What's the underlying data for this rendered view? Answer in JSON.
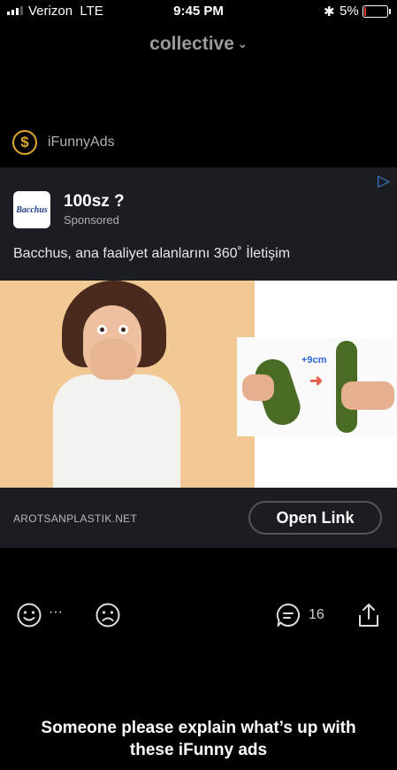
{
  "status_bar": {
    "carrier": "Verizon",
    "network": "LTE",
    "time": "9:45 PM",
    "battery_percent": "5%"
  },
  "header": {
    "title": "collective"
  },
  "ad_source": {
    "name": "iFunnyAds"
  },
  "ad": {
    "logo_text": "Bacchus",
    "advertiser": "100sz ?",
    "sponsored_label": "Sponsored",
    "text": "Bacchus, ana faaliyet alanlarını 360˚ İletişim",
    "image_overlay": "+9cm",
    "domain": "AROTSANPLASTIK.NET",
    "cta_label": "Open Link"
  },
  "actions": {
    "more": "···",
    "comment_count": "16"
  },
  "caption": {
    "line1": "Someone please explain what’s up with",
    "line2": "these iFunny ads"
  },
  "colors": {
    "accent_gold": "#e0a92d",
    "adchoices_blue": "#3d8ee6",
    "card_bg": "#1c1d22",
    "background": "#000000"
  }
}
